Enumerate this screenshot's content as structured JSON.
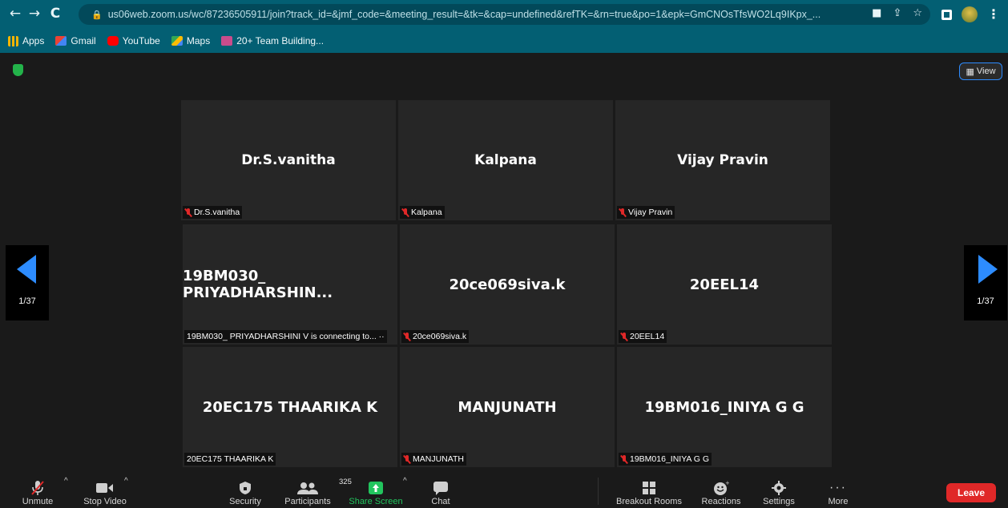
{
  "browser": {
    "url": "us06web.zoom.us/wc/87236505911/join?track_id=&jmf_code=&meeting_result=&tk=&cap=undefined&refTK=&rn=true&po=1&epk=GmCNOsTfsWO2Lq9IKpx_...",
    "bookmarks": [
      "Apps",
      "Gmail",
      "YouTube",
      "Maps",
      "20+ Team Building..."
    ]
  },
  "meeting": {
    "view_label": "View",
    "page_left": "1/37",
    "page_right": "1/37",
    "participants": [
      {
        "name": "Dr.S.vanitha",
        "label": "Dr.S.vanitha",
        "muted": true
      },
      {
        "name": "Kalpana",
        "label": "Kalpana",
        "muted": true
      },
      {
        "name": "Vijay Pravin",
        "label": "Vijay Pravin",
        "muted": true
      },
      {
        "name": "19BM030_ PRIYADHARSHIN...",
        "label": "19BM030_ PRIYADHARSHINI V is connecting to... ··",
        "muted": false
      },
      {
        "name": "20ce069siva.k",
        "label": "20ce069siva.k",
        "muted": true
      },
      {
        "name": "20EEL14",
        "label": "20EEL14",
        "muted": true
      },
      {
        "name": "20EC175 THAARIKA K",
        "label": "20EC175 THAARIKA K",
        "muted": false
      },
      {
        "name": "MANJUNATH",
        "label": "MANJUNATH",
        "muted": true
      },
      {
        "name": "19BM016_INIYA G G",
        "label": "19BM016_INIYA G G",
        "muted": true
      }
    ]
  },
  "toolbar": {
    "unmute": "Unmute",
    "stop_video": "Stop Video",
    "security": "Security",
    "participants": "Participants",
    "participants_count": "325",
    "share_screen": "Share Screen",
    "chat": "Chat",
    "breakout_rooms": "Breakout Rooms",
    "reactions": "Reactions",
    "settings": "Settings",
    "more": "More",
    "leave": "Leave"
  },
  "colors": {
    "accent": "#2d8cff",
    "leave": "#e02828",
    "share_green": "#22c55e",
    "chrome_bg": "#035f73"
  }
}
